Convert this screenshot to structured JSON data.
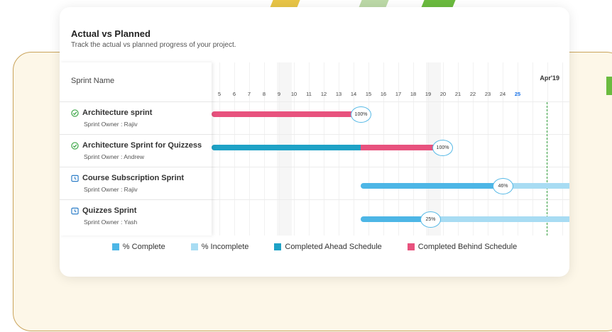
{
  "header": {
    "title": "Actual vs Planned",
    "subtitle": "Track the actual vs planned progress of your project."
  },
  "table": {
    "column_header": "Sprint Name",
    "month_label": "Apr'19",
    "days": [
      "5",
      "6",
      "7",
      "8",
      "9",
      "10",
      "11",
      "12",
      "13",
      "14",
      "15",
      "16",
      "17",
      "18",
      "19",
      "20",
      "21",
      "22",
      "23",
      "24",
      "25"
    ],
    "today": "25"
  },
  "sprints": [
    {
      "name": "Architecture sprint",
      "owner": "Sprint Owner : Rajiv",
      "status_icon": "completed-check-icon",
      "percent": "100%"
    },
    {
      "name": "Architecture Sprint for Quizzess",
      "owner": "Sprint Owner : Andrew",
      "status_icon": "completed-check-icon",
      "percent": "100%"
    },
    {
      "name": "Course Subscription Sprint",
      "owner": "Sprint Owner : Rajiv",
      "status_icon": "in-progress-clock-icon",
      "percent": "46%"
    },
    {
      "name": "Quizzes Sprint",
      "owner": "Sprint Owner : Yash",
      "status_icon": "in-progress-clock-icon",
      "percent": "25%"
    }
  ],
  "legend": [
    {
      "label": "% Complete",
      "color": "#4db6e6"
    },
    {
      "label": "% Incomplete",
      "color": "#a8dcf3"
    },
    {
      "label": "Completed Ahead Schedule",
      "color": "#1ea2c6"
    },
    {
      "label": "Completed Behind Schedule",
      "color": "#e8527e"
    }
  ],
  "colors": {
    "complete": "#4db6e6",
    "incomplete": "#a8dcf3",
    "ahead": "#1ea2c6",
    "behind": "#e8527e",
    "today_line": "#3aa544"
  }
}
